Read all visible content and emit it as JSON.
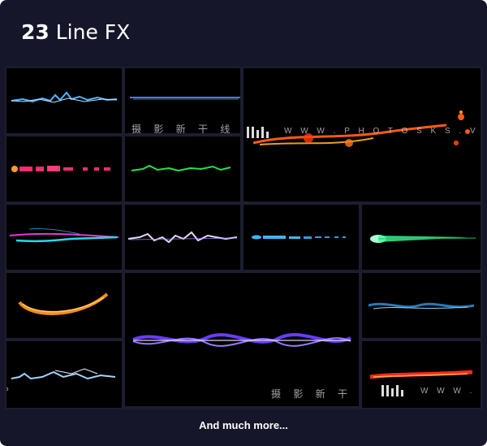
{
  "header": {
    "count": "23",
    "title": "Line FX"
  },
  "footer": {
    "label": "And much more..."
  },
  "watermarks": [
    {
      "cn": "摄 影 新 干 线",
      "url": "W W W . P H O T O S K S . V I P"
    },
    {
      "cn": "摄 影 新 干 线",
      "url": "W W W . P H O"
    }
  ],
  "left_edge_fragment": "P",
  "colors": {
    "background": "#16162a",
    "tile": "#000000",
    "accent_text": "#ffffff"
  },
  "effects": [
    {
      "name": "blue-lightning-line",
      "color": "#4fb6ff"
    },
    {
      "name": "thin-blue-beam",
      "color": "#3a7bff"
    },
    {
      "name": "fire-trail",
      "color": "#ff5a14"
    },
    {
      "name": "pink-dash-line",
      "color": "#ff2a6d"
    },
    {
      "name": "green-zigzag-line",
      "color": "#29e04a"
    },
    {
      "name": "magenta-cyan-swoosh",
      "color": "#e03ad8"
    },
    {
      "name": "white-violet-spikes",
      "color": "#e8d8ff"
    },
    {
      "name": "cyan-dotted-beam",
      "color": "#3fb6ff"
    },
    {
      "name": "green-comet",
      "color": "#3cff9a"
    },
    {
      "name": "orange-arc",
      "color": "#ff8a1a"
    },
    {
      "name": "purple-twist-beam",
      "color": "#6a3cff"
    },
    {
      "name": "blue-wave-particles",
      "color": "#2f8fd8"
    },
    {
      "name": "white-blue-zap",
      "color": "#9fd6ff"
    },
    {
      "name": "red-flame-streak",
      "color": "#ff2a14"
    }
  ]
}
